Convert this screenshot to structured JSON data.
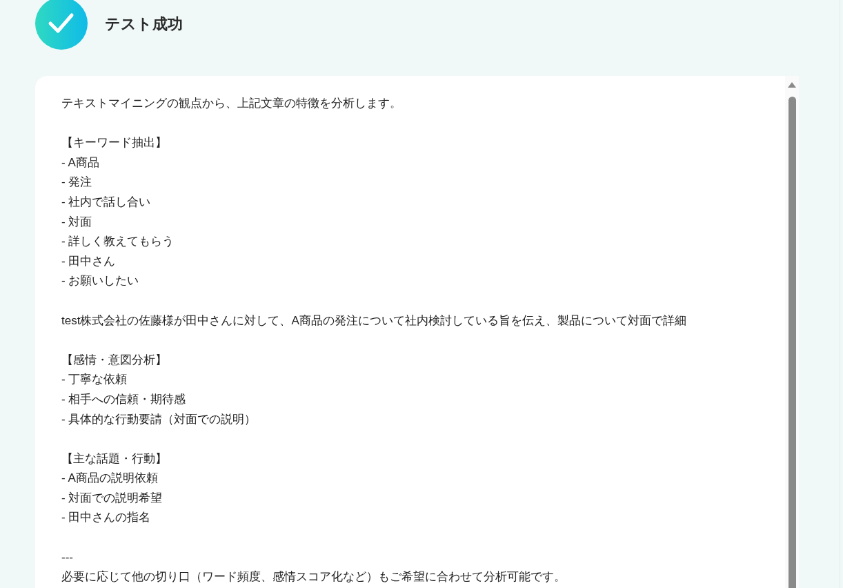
{
  "header": {
    "title": "テスト成功"
  },
  "result": {
    "blocks": [
      [
        "テキストマイニングの観点から、上記文章の特徴を分析します。"
      ],
      [
        "【キーワード抽出】",
        "- A商品",
        "- 発注",
        "- 社内で話し合い",
        "- 対面",
        "- 詳しく教えてもらう",
        "- 田中さん",
        "- お願いしたい"
      ],
      [
        "test株式会社の佐藤様が田中さんに対して、A商品の発注について社内検討している旨を伝え、製品について対面で詳細"
      ],
      [
        "【感情・意図分析】",
        "- 丁寧な依頼",
        "- 相手への信頼・期待感",
        "- 具体的な行動要請（対面での説明）"
      ],
      [
        "【主な話題・行動】",
        "- A商品の説明依頼",
        "- 対面での説明希望",
        "- 田中さんの指名"
      ],
      [
        "---",
        "必要に応じて他の切り口（ワード頻度、感情スコア化など）もご希望に合わせて分析可能です。"
      ]
    ]
  }
}
